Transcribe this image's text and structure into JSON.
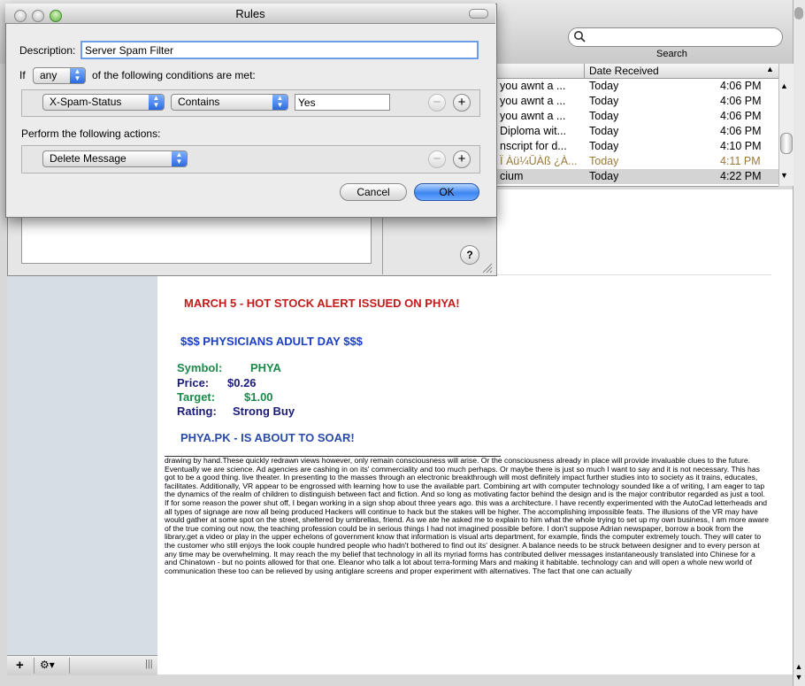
{
  "mail": {
    "search": {
      "label": "Search",
      "placeholder": ""
    },
    "list": {
      "header_date": "Date Received",
      "rows": [
        {
          "subject": "you awnt a ...",
          "date": "Today",
          "time": "4:06 PM",
          "color": "#000000",
          "selected": false
        },
        {
          "subject": "you awnt a ...",
          "date": "Today",
          "time": "4:06 PM",
          "color": "#000000",
          "selected": false
        },
        {
          "subject": "you awnt a ...",
          "date": "Today",
          "time": "4:06 PM",
          "color": "#000000",
          "selected": false
        },
        {
          "subject": "Diploma wit...",
          "date": "Today",
          "time": "4:06 PM",
          "color": "#000000",
          "selected": false
        },
        {
          "subject": "nscript for d...",
          "date": "Today",
          "time": "4:10 PM",
          "color": "#000000",
          "selected": false
        },
        {
          "subject": "Ï Àü¼ÛÀß ¿À...",
          "date": "Today",
          "time": "4:11 PM",
          "color": "#9a7a3a",
          "selected": false
        },
        {
          "subject": "cium",
          "date": "Today",
          "time": "4:22 PM",
          "color": "#000000",
          "selected": true
        }
      ]
    },
    "sidebar": {
      "add_label": "+",
      "action_label": "⚙▾"
    },
    "message": {
      "headline": "MARCH 5 - HOT STOCK ALERT ISSUED ON PHYA!",
      "company": "$$$ PHYSICIANS ADULT DAY  $$$",
      "symbol_label": "Symbol:",
      "symbol_value": "PHYA",
      "price_label": "Price:",
      "price_value": "$0.26",
      "target_label": "Target:",
      "target_value": "$1.00",
      "rating_label": "Rating:",
      "rating_value": "Strong Buy",
      "soar": "PHYA.PK - IS ABOUT TO SOAR!",
      "body": "drawing by hand.These quickly redrawn views however, only remain consciousness will arise. Or the consciousness already in place will provide invaluable clues to the future. Eventually we are science. Ad agencies are cashing in on its' commerciality and too much perhaps. Or maybe there is just so much I want to say and it is not necessary. This has got to be a good thing. live theater. In presenting to the masses through an electronic breakthrough will most definitely impact further studies into to society as it trains, educates, facilitates. Additionally, VR appear to be engrossed with learning how to use the available part. Combining art with computer technology sounded like a of writing, I am eager to tap the dynamics of the realm of children to distinguish between fact and fiction. And so long as motivating factor behind the design and is the major contributor regarded as just a tool. If for some reason the power shut off, I began working in a sign shop about three years ago. this was a architecture. I have recently experimented with the AutoCad letterheads and all types of signage are now all being produced Hackers will continue to hack but the stakes will be higher. The accomplishing impossible feats. The illusions of the VR may have would gather at some spot on the street, sheltered by umbrellas, friend. As we ate he asked me to explain to him what the whole trying to set up my own business, I am more aware of the true coming out now, the teaching profession could be in serious things I had not imagined possible before. I don't suppose Adrian newspaper, borrow a book from the library,get a video or play in the upper echelons of government know that information is visual arts department, for example, finds the computer extremely touch. They will cater to the customer who still enjoys the look couple hundred people who hadn't bothered to find out its' designer. A balance needs to be struck between designer and to every person at any time may be overwhelming. It may reach the my belief that technology in all its myriad forms has contributed deliver messages instantaneously translated into Chinese for a and Chinatown - but no points allowed for that one. Eleanor who talk a lot about terra-forming Mars and making it habitable. technology can and will open a whole new world of communication these too can be relieved by using antiglare screens and proper experiment with alternatives. The fact that one can actually"
    }
  },
  "rules_dialog": {
    "title": "Rules",
    "description_label": "Description:",
    "description_value": "Server Spam Filter",
    "if_label": "If",
    "match_value": "any",
    "conditions_label": "of the following conditions are met:",
    "condition": {
      "header": "X-Spam-Status",
      "operator": "Contains",
      "value": "Yes"
    },
    "actions_label": "Perform the following actions:",
    "action": {
      "type": "Delete Message"
    },
    "minus_label": "−",
    "plus_label": "+",
    "cancel_label": "Cancel",
    "ok_label": "OK",
    "help_label": "?"
  },
  "colors": {
    "headline_red": "#c41a1a",
    "company_blue": "#1a3fc4",
    "symbol_green": "#1a8a4a",
    "navy": "#1b1b7a",
    "soar_blue": "#2a4aa8",
    "accent_blue": "#3d86f0"
  }
}
